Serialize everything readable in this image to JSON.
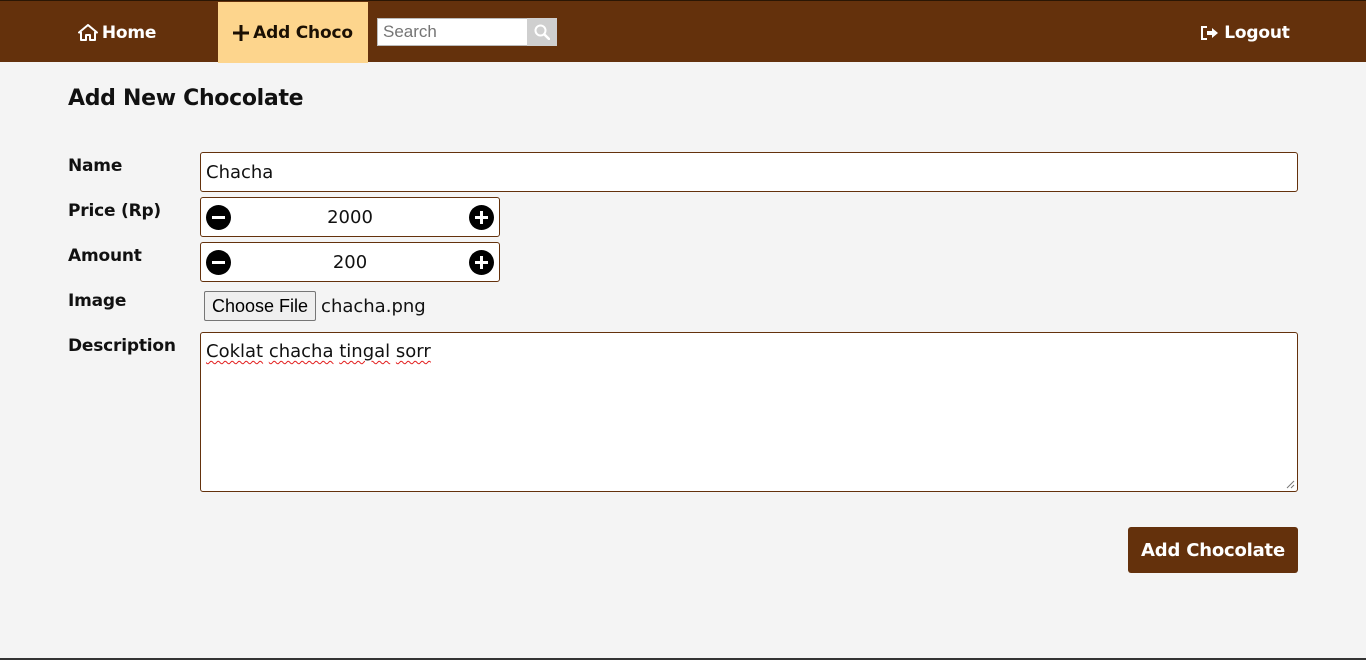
{
  "nav": {
    "home_label": "Home",
    "home_icon": "home-icon",
    "add_label": "Add Choco",
    "add_icon": "plus-icon",
    "search_placeholder": "Search",
    "search_icon": "search-icon",
    "logout_label": "Logout",
    "logout_icon": "logout-icon"
  },
  "page": {
    "title": "Add New Chocolate"
  },
  "form": {
    "name": {
      "label": "Name",
      "value": "Chacha"
    },
    "price": {
      "label": "Price (Rp)",
      "value": "2000"
    },
    "amount": {
      "label": "Amount",
      "value": "200"
    },
    "image": {
      "label": "Image",
      "button_label": "Choose File",
      "file_name": "chacha.png"
    },
    "description": {
      "label": "Description",
      "words": [
        "Coklat",
        "chacha",
        "tingal",
        "sorr"
      ]
    },
    "submit_label": "Add Chocolate"
  },
  "colors": {
    "brand_brown": "#64310c",
    "active_tab": "#fdd58d",
    "background": "#f4f4f4"
  }
}
